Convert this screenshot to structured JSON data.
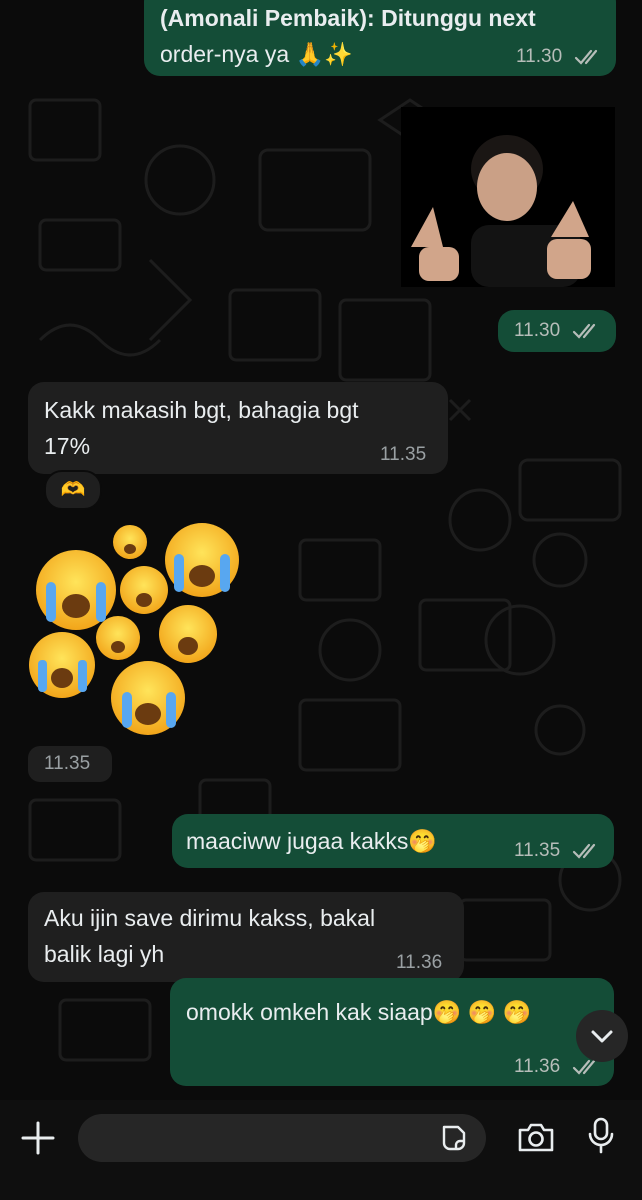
{
  "messages": {
    "m1": {
      "line1": "(Amonali Pembaik): Ditunggu next",
      "line2": "order-nya ya 🙏✨",
      "time": "11.30"
    },
    "m2": {
      "time": "11.30"
    },
    "m3": {
      "line1": "Kakk makasih bgt, bahagia bgt",
      "line2": "17%",
      "time": "11.35",
      "reaction": "🫶"
    },
    "m4": {
      "time": "11.35"
    },
    "m5": {
      "text": "maaciww jugaa kakks🤭",
      "time": "11.35"
    },
    "m6": {
      "line1": "Aku ijin save dirimu kakss, bakal",
      "line2": "balik lagi yh",
      "time": "11.36"
    },
    "m7": {
      "text": "omokk omkeh kak siaap🤭 🤭 🤭",
      "time": "11.36"
    }
  },
  "composer": {
    "placeholder": ""
  },
  "icons": {
    "plus": "plus-icon",
    "sticker": "sticker-icon",
    "camera": "camera-icon",
    "mic": "microphone-icon",
    "scroll": "chevron-down-icon",
    "ticks": "double-check-icon"
  },
  "colors": {
    "outgoing": "#144d37",
    "incoming": "#1f1f1f",
    "tick": "#b6bdb9"
  }
}
